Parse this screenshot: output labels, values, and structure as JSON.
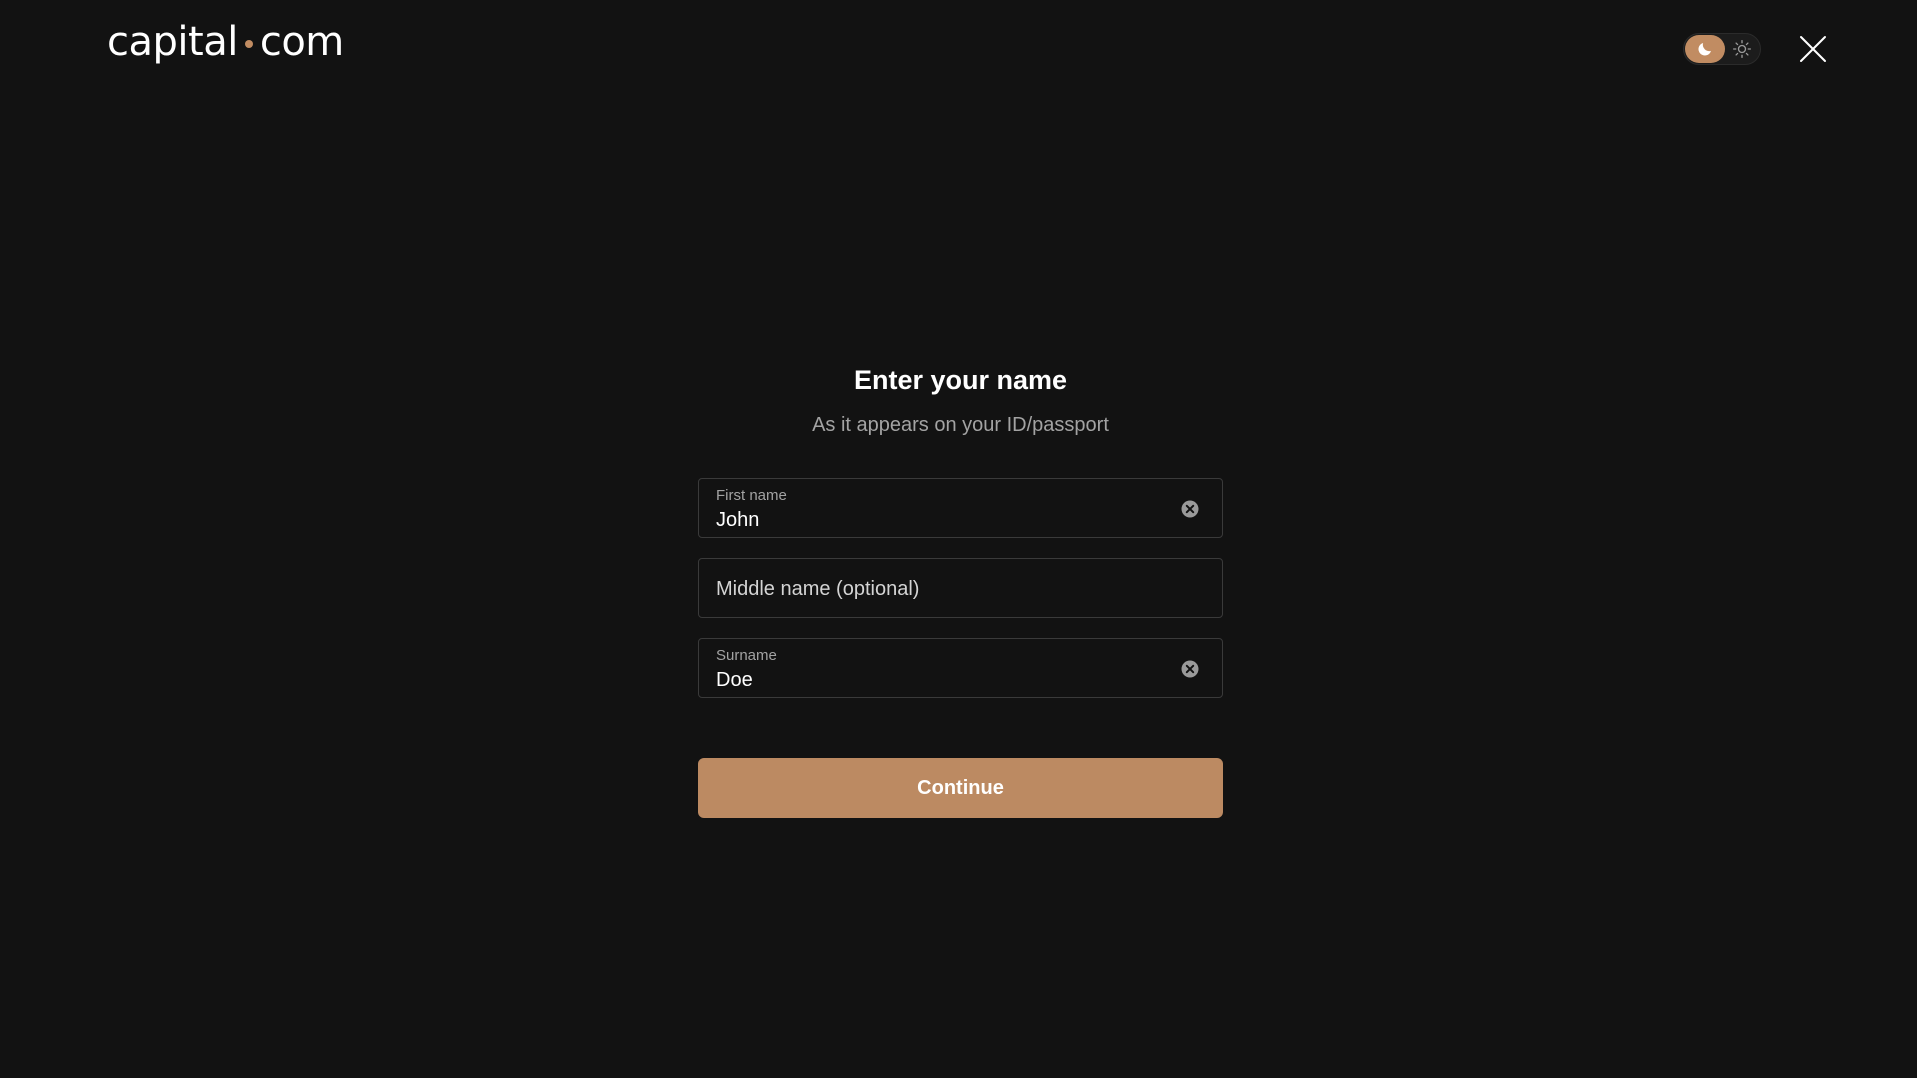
{
  "header": {
    "logo_left": "capital",
    "logo_right": "com",
    "theme_toggle_icons": [
      "moon-icon",
      "sun-icon"
    ],
    "close_icon": "close-icon"
  },
  "form": {
    "title": "Enter your name",
    "subtitle": "As it appears on your ID/passport",
    "first_name": {
      "label": "First name",
      "value": "John"
    },
    "middle_name": {
      "placeholder": "Middle name (optional)",
      "value": ""
    },
    "surname": {
      "label": "Surname",
      "value": "Doe"
    },
    "continue_label": "Continue"
  },
  "colors": {
    "background": "#121212",
    "accent": "#bc8a62",
    "field_border": "#3a3a3a",
    "muted_text": "#a3a3a3"
  }
}
